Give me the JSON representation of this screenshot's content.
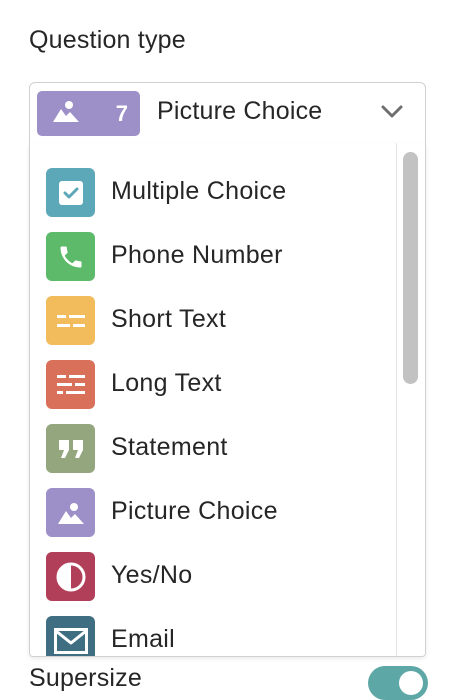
{
  "question_type": {
    "label": "Question type",
    "selected": {
      "number": "7",
      "label": "Picture Choice",
      "icon": "picture-icon",
      "color": "#9d8fc8"
    }
  },
  "options": [
    {
      "label": "Multiple Choice",
      "icon": "checkbox-icon",
      "color": "#5da8b8"
    },
    {
      "label": "Phone Number",
      "icon": "phone-icon",
      "color": "#5cba6a"
    },
    {
      "label": "Short Text",
      "icon": "short-text-icon",
      "color": "#f2bc5d"
    },
    {
      "label": "Long Text",
      "icon": "long-text-icon",
      "color": "#d9705a"
    },
    {
      "label": "Statement",
      "icon": "quote-icon",
      "color": "#93a67e"
    },
    {
      "label": "Picture Choice",
      "icon": "picture-icon",
      "color": "#9d8fc8"
    },
    {
      "label": "Yes/No",
      "icon": "yes-no-icon",
      "color": "#b23f5a"
    },
    {
      "label": "Email",
      "icon": "envelope-icon",
      "color": "#3f6e82"
    }
  ],
  "supersize": {
    "label": "Supersize",
    "enabled": true,
    "toggle_color": "#5da8a6"
  }
}
